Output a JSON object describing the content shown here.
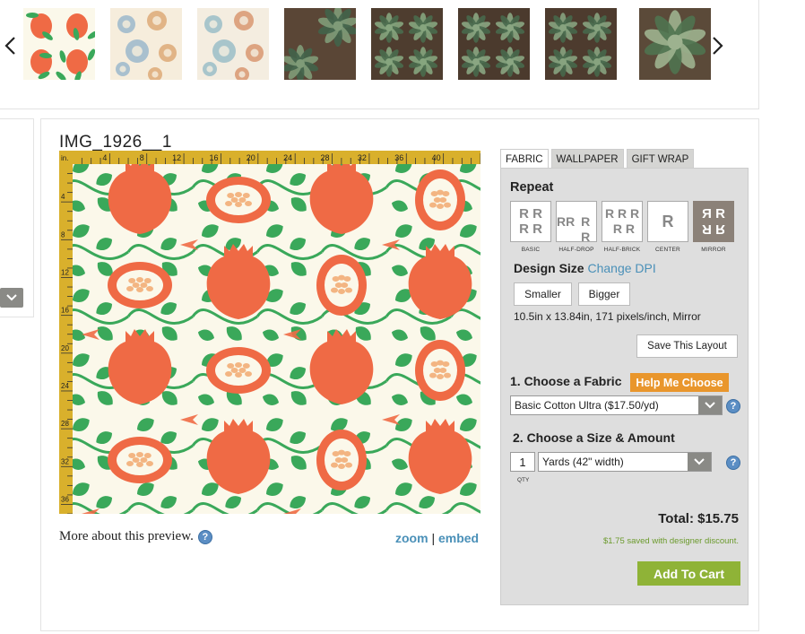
{
  "thumbnails": [
    {
      "name": "pomegranate-pattern-thumb",
      "colors": {
        "bg": "#fbf8ea",
        "a": "#ef6a45",
        "b": "#3aa85a"
      }
    },
    {
      "name": "watercolor-circles-thumb",
      "colors": {
        "bg": "#f6eddc",
        "a": "#d9a06a",
        "b": "#8fb0c9"
      }
    },
    {
      "name": "watercolor-circles-thumb-2",
      "colors": {
        "bg": "#f4ede0",
        "a": "#d68b62",
        "b": "#8fb7c4"
      }
    },
    {
      "name": "succulent-photo-thumb",
      "colors": {
        "bg": "#5a4636",
        "a": "#41634a",
        "b": "#7f9b78"
      }
    },
    {
      "name": "succulent-photo-thumb-2",
      "colors": {
        "bg": "#4e3d2f",
        "a": "#4a6c4e",
        "b": "#86a57e"
      }
    },
    {
      "name": "succulent-repeat-thumb",
      "colors": {
        "bg": "#4b3a2d",
        "a": "#48694c",
        "b": "#8aa682"
      }
    },
    {
      "name": "succulent-repeat-thumb-2",
      "colors": {
        "bg": "#4d3b2e",
        "a": "#47684b",
        "b": "#87a37f"
      }
    },
    {
      "name": "succulent-large-thumb",
      "colors": {
        "bg": "#5b4a39",
        "a": "#4f7350",
        "b": "#9db28f"
      }
    }
  ],
  "design": {
    "title": "IMG_1926__1",
    "ruler_unit": "in.",
    "ruler_top_ticks": [
      "4",
      "8",
      "12",
      "16",
      "20",
      "24",
      "28",
      "32",
      "36",
      "40"
    ],
    "ruler_left_ticks": [
      "4",
      "8",
      "12",
      "16",
      "20",
      "24",
      "28",
      "32",
      "36"
    ],
    "more_about": "More about this preview.",
    "zoom": "zoom",
    "separator": "|",
    "embed": "embed"
  },
  "tabs": [
    {
      "label": "FABRIC",
      "active": true
    },
    {
      "label": "WALLPAPER",
      "active": false
    },
    {
      "label": "GIFT WRAP",
      "active": false
    }
  ],
  "repeat": {
    "heading": "Repeat",
    "options": [
      {
        "label": "BASIC",
        "glyph": "R R\nR R",
        "selected": false
      },
      {
        "label": "HALF-DROP",
        "glyph": "R R\nR R",
        "selected": false
      },
      {
        "label": "HALF-BRICK",
        "glyph": "R R R\nR R",
        "selected": false
      },
      {
        "label": "CENTER",
        "glyph": "R",
        "selected": false
      },
      {
        "label": "MIRROR",
        "glyph": "R R\nR R",
        "selected": true
      }
    ]
  },
  "design_size": {
    "heading": "Design Size",
    "change_dpi": "Change DPI",
    "smaller": "Smaller",
    "bigger": "Bigger",
    "dimensions": "10.5in x 13.84in, 171 pixels/inch, Mirror",
    "save_layout": "Save This Layout"
  },
  "fabric": {
    "heading": "1. Choose a Fabric",
    "help_label": "Help Me Choose",
    "selected": "Basic Cotton Ultra ($17.50/yd)"
  },
  "size": {
    "heading": "2. Choose a Size & Amount",
    "qty": "1",
    "qty_label": "QTY",
    "unit": "Yards (42\" width)"
  },
  "pricing": {
    "total": "Total: $15.75",
    "discount": "$1.75 saved with designer discount.",
    "add_to_cart": "Add To Cart"
  },
  "colors": {
    "accent_blue": "#4a90b8",
    "orange": "#e9962c",
    "green": "#8fb337",
    "ruler_gold": "#d9b02c",
    "panel_gray": "#dedede",
    "pattern_red": "#ef6a45",
    "pattern_green": "#3aa85a",
    "pattern_cream": "#fbf8ea",
    "seed_orange": "#f3b582"
  }
}
